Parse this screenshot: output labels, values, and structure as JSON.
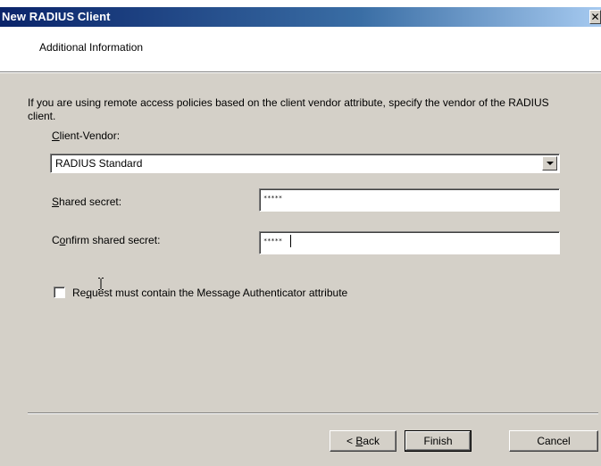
{
  "window": {
    "title": "New RADIUS Client",
    "close_glyph": "✕"
  },
  "header": {
    "title": "Additional Information"
  },
  "main": {
    "description": "If you are using remote access policies based on the client vendor attribute, specify the vendor of the RADIUS client.",
    "client_vendor": {
      "label_accel": "C",
      "label_rest": "lient-Vendor:",
      "selected": "RADIUS Standard"
    },
    "shared_secret": {
      "label_accel": "S",
      "label_rest": "hared secret:",
      "value": "*****"
    },
    "confirm_secret": {
      "label_pre": "C",
      "label_accel": "o",
      "label_rest": "nfirm shared secret:",
      "value": "*****"
    },
    "message_auth": {
      "label_pre": "Re",
      "label_accel": "q",
      "label_rest": "uest must contain the Message Authenticator attribute",
      "checked": false
    }
  },
  "footer": {
    "back_pre": "< ",
    "back_accel": "B",
    "back_rest": "ack",
    "finish": "Finish",
    "cancel": "Cancel"
  }
}
